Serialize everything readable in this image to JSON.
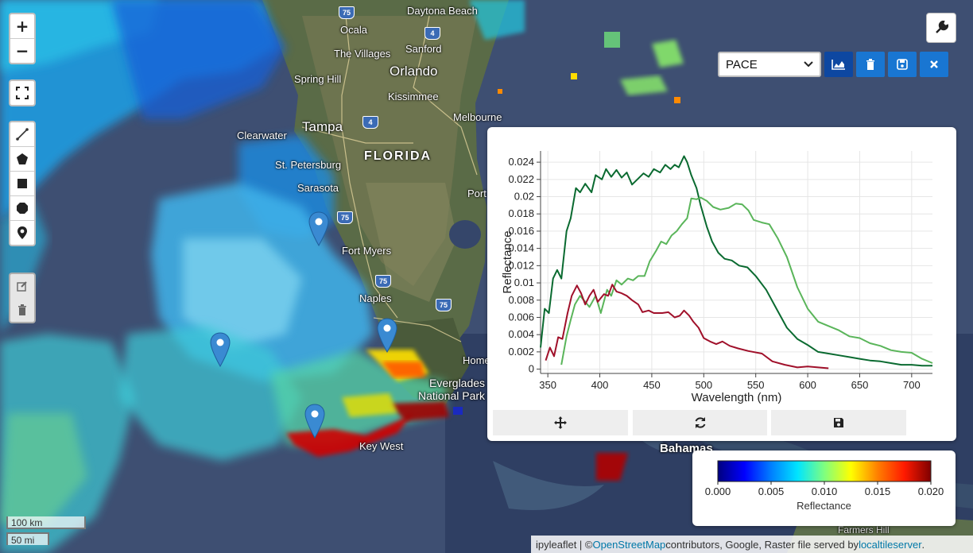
{
  "map": {
    "zoom_in": "+",
    "zoom_out": "−",
    "icons": {
      "fullscreen": "fullscreen-icon",
      "polyline": "polyline-icon",
      "polygon": "polygon-icon",
      "rectangle": "rectangle-icon",
      "circle": "circle-icon",
      "marker": "marker-icon",
      "edit": "edit-icon",
      "delete": "trash-icon",
      "wrench": "wrench-icon"
    },
    "place_labels": {
      "daytona_beach": "Daytona Beach",
      "ocala": "Ocala",
      "the_villages": "The Villages",
      "sanford": "Sanford",
      "orlando": "Orlando",
      "spring_hill": "Spring Hill",
      "kissimmee": "Kissimmee",
      "melbourne": "Melbourne",
      "tampa": "Tampa",
      "clearwater": "Clearwater",
      "st_petersburg": "St. Petersburg",
      "florida": "FLORIDA",
      "sarasota": "Sarasota",
      "port": "Port",
      "fort_myers": "Fort Myers",
      "naples": "Naples",
      "homestead": "Home",
      "everglades": "Everglades",
      "national_park": "National Park",
      "key_west": "Key West",
      "bahamas": "Bahamas",
      "farmers_hill": "Farmers Hill"
    },
    "highway_shields": [
      "75",
      "4",
      "4",
      "75",
      "75",
      "75"
    ]
  },
  "toolbar": {
    "selected_layer": "PACE",
    "chart_icon": "line-chart-icon",
    "delete_icon": "trash-icon",
    "save_icon": "save-icon",
    "close_icon": "close-icon"
  },
  "plot_panel": {
    "buttons": {
      "pan_icon": "move-icon",
      "reset_icon": "refresh-icon",
      "save_icon": "save-icon"
    }
  },
  "chart_data": {
    "type": "line",
    "xlabel": "Wavelength (nm)",
    "ylabel": "Reflectance",
    "xlim": [
      343,
      720
    ],
    "ylim": [
      -0.0005,
      0.0253
    ],
    "xticks": [
      350,
      400,
      450,
      500,
      550,
      600,
      650,
      700
    ],
    "yticks": [
      0,
      0.002,
      0.004,
      0.006,
      0.008,
      0.01,
      0.012,
      0.014,
      0.016,
      0.018,
      0.02,
      0.022,
      0.024
    ],
    "ytick_labels": [
      "0",
      "0.002",
      "0.004",
      "0.006",
      "0.008",
      "0.01",
      "0.012",
      "0.014",
      "0.016",
      "0.018",
      "0.02",
      "0.022",
      "0.024"
    ],
    "grid": true,
    "series": [
      {
        "color": "#0a6a30",
        "x": [
          343,
          347,
          351,
          355,
          359,
          363,
          368,
          372,
          377,
          381,
          386,
          392,
          396,
          402,
          406,
          411,
          416,
          421,
          426,
          431,
          437,
          442,
          447,
          452,
          458,
          463,
          468,
          472,
          476,
          481,
          484,
          488,
          493,
          497,
          503,
          508,
          514,
          520,
          527,
          534,
          542,
          550,
          560,
          570,
          580,
          590,
          600,
          610,
          620,
          630,
          640,
          650,
          660,
          670,
          680,
          690,
          700,
          710,
          720
        ],
        "y": [
          0.0025,
          0.007,
          0.0065,
          0.0105,
          0.0115,
          0.0105,
          0.016,
          0.0175,
          0.021,
          0.0205,
          0.0215,
          0.0205,
          0.0225,
          0.022,
          0.0232,
          0.0223,
          0.0231,
          0.0222,
          0.0228,
          0.0214,
          0.0221,
          0.0227,
          0.0223,
          0.0232,
          0.0228,
          0.0237,
          0.0232,
          0.0237,
          0.0234,
          0.0247,
          0.024,
          0.0225,
          0.021,
          0.019,
          0.0165,
          0.0148,
          0.0135,
          0.0128,
          0.0126,
          0.012,
          0.0118,
          0.0108,
          0.0092,
          0.007,
          0.0048,
          0.0035,
          0.0028,
          0.002,
          0.0018,
          0.0016,
          0.0014,
          0.0012,
          0.001,
          0.0009,
          0.0007,
          0.0005,
          0.0005,
          0.0004,
          0.0004
        ]
      },
      {
        "color": "#5ab55a",
        "x": [
          363,
          368,
          372,
          376,
          381,
          386,
          390,
          396,
          401,
          407,
          411,
          416,
          421,
          427,
          432,
          437,
          443,
          448,
          454,
          459,
          464,
          469,
          474,
          479,
          484,
          488,
          493,
          497,
          503,
          509,
          516,
          524,
          531,
          537,
          543,
          548,
          556,
          563,
          571,
          580,
          590,
          600,
          610,
          620,
          630,
          640,
          650,
          660,
          670,
          680,
          690,
          700,
          710,
          720
        ],
        "y": [
          0.0005,
          0.0038,
          0.0057,
          0.0075,
          0.0085,
          0.0078,
          0.0072,
          0.0085,
          0.0065,
          0.0092,
          0.0085,
          0.0103,
          0.0098,
          0.0105,
          0.0103,
          0.0108,
          0.0108,
          0.0125,
          0.0137,
          0.0148,
          0.0145,
          0.0155,
          0.016,
          0.0168,
          0.0175,
          0.0198,
          0.0197,
          0.0199,
          0.0195,
          0.0188,
          0.0185,
          0.0187,
          0.0192,
          0.0191,
          0.0184,
          0.0173,
          0.017,
          0.0168,
          0.0152,
          0.013,
          0.0095,
          0.007,
          0.0055,
          0.005,
          0.0045,
          0.0038,
          0.0036,
          0.003,
          0.0027,
          0.0022,
          0.002,
          0.0019,
          0.0012,
          0.0007
        ]
      },
      {
        "color": "#a0102a",
        "x": [
          348,
          352,
          356,
          360,
          364,
          369,
          373,
          378,
          382,
          386,
          390,
          394,
          398,
          404,
          408,
          412,
          416,
          421,
          426,
          431,
          437,
          441,
          447,
          452,
          460,
          466,
          472,
          477,
          481,
          486,
          490,
          495,
          500,
          506,
          512,
          518,
          525,
          533,
          543,
          556,
          566,
          578,
          590,
          600,
          610,
          620
        ],
        "y": [
          0.001,
          0.0025,
          0.0015,
          0.0037,
          0.0035,
          0.0065,
          0.0085,
          0.0097,
          0.0088,
          0.0075,
          0.0085,
          0.0092,
          0.0078,
          0.0087,
          0.0085,
          0.0098,
          0.009,
          0.0088,
          0.0085,
          0.008,
          0.0075,
          0.0066,
          0.0068,
          0.0065,
          0.0065,
          0.0066,
          0.006,
          0.0062,
          0.0068,
          0.0062,
          0.0055,
          0.0048,
          0.0036,
          0.0032,
          0.0029,
          0.0032,
          0.0027,
          0.0024,
          0.0021,
          0.0018,
          0.0009,
          0.0005,
          0.0002,
          0.0003,
          0.0002,
          0.0001
        ]
      }
    ]
  },
  "legend": {
    "title": "Reflectance",
    "tick_labels": [
      "0.000",
      "0.005",
      "0.010",
      "0.015",
      "0.020"
    ],
    "colormap": [
      "#00007f",
      "#0000ff",
      "#007fff",
      "#00e5ff",
      "#7fff7f",
      "#ffff00",
      "#ff7f00",
      "#ff1a00",
      "#7f0000"
    ]
  },
  "scale": {
    "km": "100 km",
    "mi": "50 mi"
  },
  "attribution": {
    "prefix": "ipyleaflet | © ",
    "osm_link": "OpenStreetMap",
    "middle": " contributors, Google, Raster file served by ",
    "server_link": "localtileserver",
    "suffix": "."
  }
}
